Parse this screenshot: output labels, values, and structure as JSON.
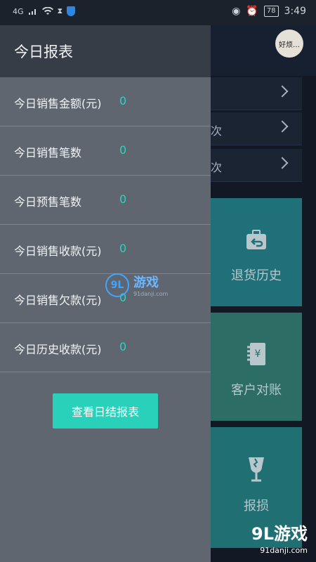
{
  "status_bar": {
    "network": "4G",
    "battery": "78",
    "time": "3:49"
  },
  "background": {
    "avatar_text": "好烦…",
    "rows": [
      "",
      "次",
      "次"
    ],
    "tiles": [
      {
        "label": "退货历史",
        "icon": "return-bag-icon"
      },
      {
        "label": "客户对账",
        "icon": "yen-document-icon"
      },
      {
        "label": "报损",
        "icon": "broken-glass-icon"
      }
    ]
  },
  "drawer": {
    "title": "今日报表",
    "stats": [
      {
        "label": "今日销售金额(元)",
        "value": "0"
      },
      {
        "label": "今日销售笔数",
        "value": "0"
      },
      {
        "label": "今日预售笔数",
        "value": "0"
      },
      {
        "label": "今日销售收款(元)",
        "value": "0"
      },
      {
        "label": "今日销售欠款(元)",
        "value": "0"
      },
      {
        "label": "今日历史收款(元)",
        "value": "0"
      }
    ],
    "button_label": "查看日结报表"
  },
  "watermark": {
    "center_logo": "9L",
    "center_text": "游戏",
    "center_sub": "91danji.com",
    "bottom_logo": "9L游戏",
    "bottom_sub": "91danji.com"
  },
  "colors": {
    "accent": "#2ad1ba",
    "drawer_bg": "#5f6670",
    "drawer_header": "#363d46"
  }
}
